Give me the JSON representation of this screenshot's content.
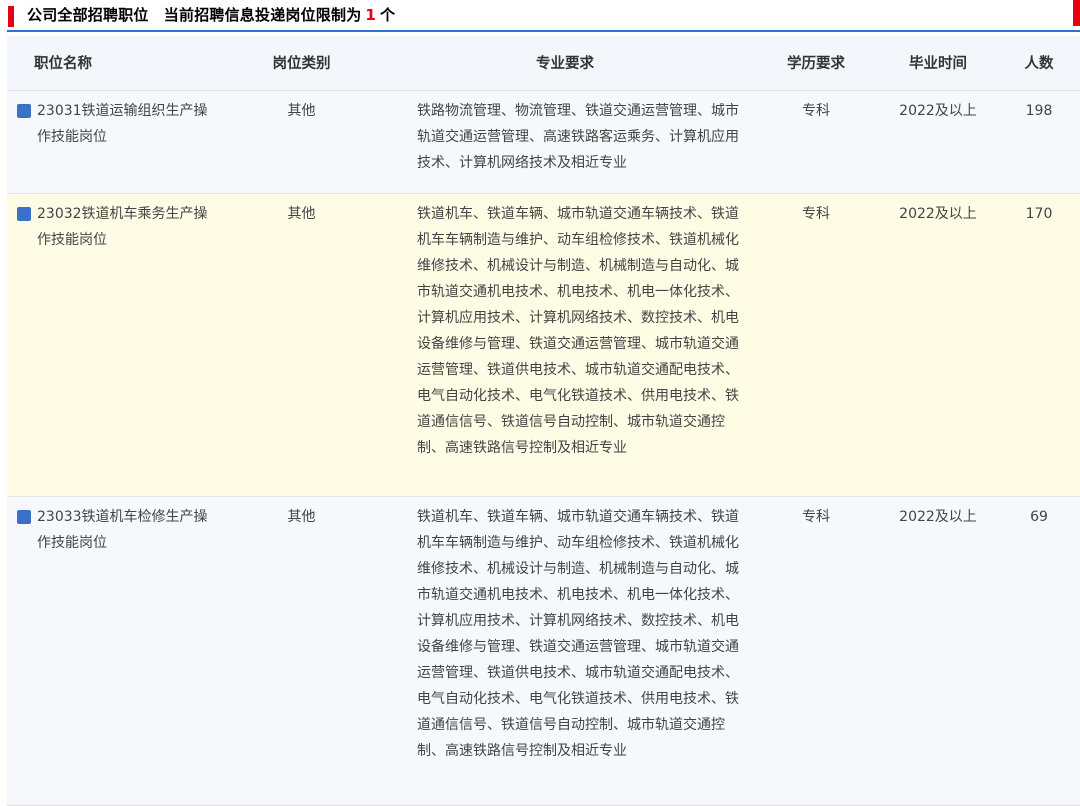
{
  "header": {
    "title_prefix": "公司全部招聘职位　当前招聘信息投递岗位限制为",
    "limit_count": "1",
    "title_suffix": "个",
    "accent_color": "#e60012",
    "underline_color": "#2f6fd1"
  },
  "table": {
    "columns": [
      "职位名称",
      "岗位类别",
      "专业要求",
      "学历要求",
      "毕业时间",
      "人数"
    ],
    "rows": [
      {
        "name": "23031铁道运输组织生产操作技能岗位",
        "category": "其他",
        "major": "铁路物流管理、物流管理、铁道交通运营管理、城市轨道交通运营管理、高速铁路客运乘务、计算机应用技术、计算机网络技术及相近专业",
        "education": "专科",
        "graduation": "2022及以上",
        "count": "198"
      },
      {
        "name": "23032铁道机车乘务生产操作技能岗位",
        "category": "其他",
        "major": "铁道机车、铁道车辆、城市轨道交通车辆技术、铁道机车车辆制造与维护、动车组检修技术、铁道机械化维修技术、机械设计与制造、机械制造与自动化、城市轨道交通机电技术、机电技术、机电一体化技术、计算机应用技术、计算机网络技术、数控技术、机电设备维修与管理、铁道交通运营管理、城市轨道交通运营管理、铁道供电技术、城市轨道交通配电技术、电气自动化技术、电气化铁道技术、供用电技术、铁道通信信号、铁道信号自动控制、城市轨道交通控制、高速铁路信号控制及相近专业",
        "education": "专科",
        "graduation": "2022及以上",
        "count": "170"
      },
      {
        "name": "23033铁道机车检修生产操作技能岗位",
        "category": "其他",
        "major": "铁道机车、铁道车辆、城市轨道交通车辆技术、铁道机车车辆制造与维护、动车组检修技术、铁道机械化维修技术、机械设计与制造、机械制造与自动化、城市轨道交通机电技术、机电技术、机电一体化技术、计算机应用技术、计算机网络技术、数控技术、机电设备维修与管理、铁道交通运营管理、城市轨道交通运营管理、铁道供电技术、城市轨道交通配电技术、电气自动化技术、电气化铁道技术、供用电技术、铁道通信信号、铁道信号自动控制、城市轨道交通控制、高速铁路信号控制及相近专业",
        "education": "专科",
        "graduation": "2022及以上",
        "count": "69"
      }
    ]
  }
}
